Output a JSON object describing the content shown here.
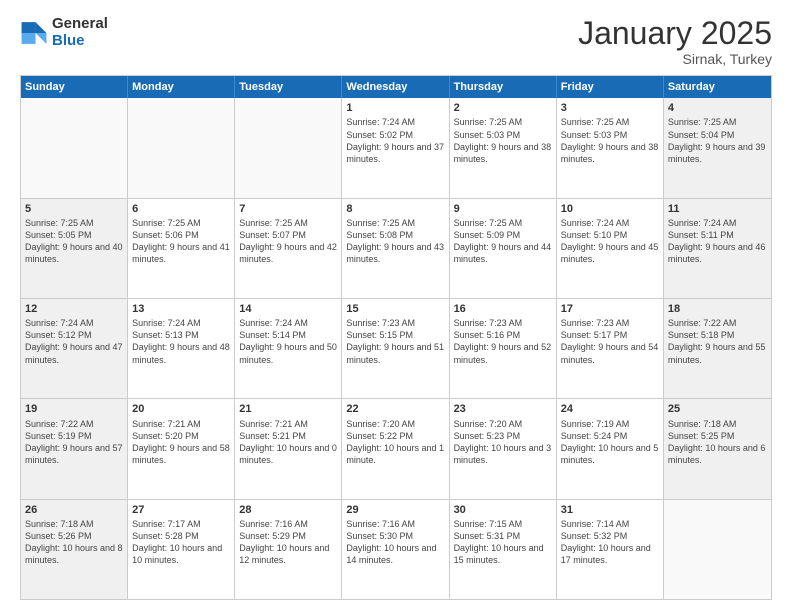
{
  "logo": {
    "general": "General",
    "blue": "Blue"
  },
  "header": {
    "month": "January 2025",
    "location": "Sirnak, Turkey"
  },
  "weekdays": [
    "Sunday",
    "Monday",
    "Tuesday",
    "Wednesday",
    "Thursday",
    "Friday",
    "Saturday"
  ],
  "rows": [
    [
      {
        "day": "",
        "text": "",
        "empty": true
      },
      {
        "day": "",
        "text": "",
        "empty": true
      },
      {
        "day": "",
        "text": "",
        "empty": true
      },
      {
        "day": "1",
        "text": "Sunrise: 7:24 AM\nSunset: 5:02 PM\nDaylight: 9 hours\nand 37 minutes."
      },
      {
        "day": "2",
        "text": "Sunrise: 7:25 AM\nSunset: 5:03 PM\nDaylight: 9 hours\nand 38 minutes."
      },
      {
        "day": "3",
        "text": "Sunrise: 7:25 AM\nSunset: 5:03 PM\nDaylight: 9 hours\nand 38 minutes."
      },
      {
        "day": "4",
        "text": "Sunrise: 7:25 AM\nSunset: 5:04 PM\nDaylight: 9 hours\nand 39 minutes."
      }
    ],
    [
      {
        "day": "5",
        "text": "Sunrise: 7:25 AM\nSunset: 5:05 PM\nDaylight: 9 hours\nand 40 minutes."
      },
      {
        "day": "6",
        "text": "Sunrise: 7:25 AM\nSunset: 5:06 PM\nDaylight: 9 hours\nand 41 minutes."
      },
      {
        "day": "7",
        "text": "Sunrise: 7:25 AM\nSunset: 5:07 PM\nDaylight: 9 hours\nand 42 minutes."
      },
      {
        "day": "8",
        "text": "Sunrise: 7:25 AM\nSunset: 5:08 PM\nDaylight: 9 hours\nand 43 minutes."
      },
      {
        "day": "9",
        "text": "Sunrise: 7:25 AM\nSunset: 5:09 PM\nDaylight: 9 hours\nand 44 minutes."
      },
      {
        "day": "10",
        "text": "Sunrise: 7:24 AM\nSunset: 5:10 PM\nDaylight: 9 hours\nand 45 minutes."
      },
      {
        "day": "11",
        "text": "Sunrise: 7:24 AM\nSunset: 5:11 PM\nDaylight: 9 hours\nand 46 minutes."
      }
    ],
    [
      {
        "day": "12",
        "text": "Sunrise: 7:24 AM\nSunset: 5:12 PM\nDaylight: 9 hours\nand 47 minutes."
      },
      {
        "day": "13",
        "text": "Sunrise: 7:24 AM\nSunset: 5:13 PM\nDaylight: 9 hours\nand 48 minutes."
      },
      {
        "day": "14",
        "text": "Sunrise: 7:24 AM\nSunset: 5:14 PM\nDaylight: 9 hours\nand 50 minutes."
      },
      {
        "day": "15",
        "text": "Sunrise: 7:23 AM\nSunset: 5:15 PM\nDaylight: 9 hours\nand 51 minutes."
      },
      {
        "day": "16",
        "text": "Sunrise: 7:23 AM\nSunset: 5:16 PM\nDaylight: 9 hours\nand 52 minutes."
      },
      {
        "day": "17",
        "text": "Sunrise: 7:23 AM\nSunset: 5:17 PM\nDaylight: 9 hours\nand 54 minutes."
      },
      {
        "day": "18",
        "text": "Sunrise: 7:22 AM\nSunset: 5:18 PM\nDaylight: 9 hours\nand 55 minutes."
      }
    ],
    [
      {
        "day": "19",
        "text": "Sunrise: 7:22 AM\nSunset: 5:19 PM\nDaylight: 9 hours\nand 57 minutes."
      },
      {
        "day": "20",
        "text": "Sunrise: 7:21 AM\nSunset: 5:20 PM\nDaylight: 9 hours\nand 58 minutes."
      },
      {
        "day": "21",
        "text": "Sunrise: 7:21 AM\nSunset: 5:21 PM\nDaylight: 10 hours\nand 0 minutes."
      },
      {
        "day": "22",
        "text": "Sunrise: 7:20 AM\nSunset: 5:22 PM\nDaylight: 10 hours\nand 1 minute."
      },
      {
        "day": "23",
        "text": "Sunrise: 7:20 AM\nSunset: 5:23 PM\nDaylight: 10 hours\nand 3 minutes."
      },
      {
        "day": "24",
        "text": "Sunrise: 7:19 AM\nSunset: 5:24 PM\nDaylight: 10 hours\nand 5 minutes."
      },
      {
        "day": "25",
        "text": "Sunrise: 7:18 AM\nSunset: 5:25 PM\nDaylight: 10 hours\nand 6 minutes."
      }
    ],
    [
      {
        "day": "26",
        "text": "Sunrise: 7:18 AM\nSunset: 5:26 PM\nDaylight: 10 hours\nand 8 minutes."
      },
      {
        "day": "27",
        "text": "Sunrise: 7:17 AM\nSunset: 5:28 PM\nDaylight: 10 hours\nand 10 minutes."
      },
      {
        "day": "28",
        "text": "Sunrise: 7:16 AM\nSunset: 5:29 PM\nDaylight: 10 hours\nand 12 minutes."
      },
      {
        "day": "29",
        "text": "Sunrise: 7:16 AM\nSunset: 5:30 PM\nDaylight: 10 hours\nand 14 minutes."
      },
      {
        "day": "30",
        "text": "Sunrise: 7:15 AM\nSunset: 5:31 PM\nDaylight: 10 hours\nand 15 minutes."
      },
      {
        "day": "31",
        "text": "Sunrise: 7:14 AM\nSunset: 5:32 PM\nDaylight: 10 hours\nand 17 minutes."
      },
      {
        "day": "",
        "text": "",
        "empty": true
      }
    ]
  ]
}
